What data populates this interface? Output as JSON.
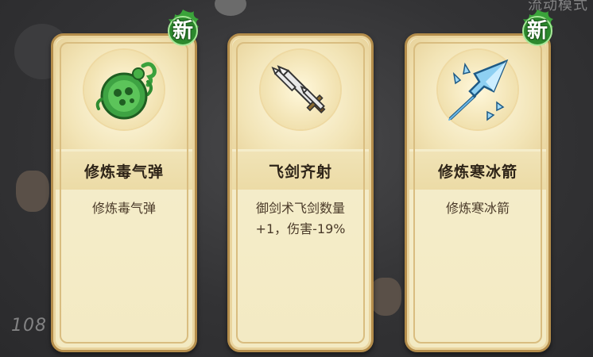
{
  "background": {
    "top_right_text": "流动模式",
    "bottom_left_text": "108"
  },
  "badge": {
    "new_label": "新"
  },
  "cards": [
    {
      "title": "修炼毒气弹",
      "description": "修炼毒气弹",
      "icon": "poison-gas-orb-icon",
      "is_new": true
    },
    {
      "title": "飞剑齐射",
      "description": "御剑术飞剑数量\n+1，伤害-19%",
      "icon": "flying-swords-icon",
      "is_new": false
    },
    {
      "title": "修炼寒冰箭",
      "description": "修炼寒冰箭",
      "icon": "ice-arrow-icon",
      "is_new": true
    }
  ],
  "colors": {
    "card_bg": "#f4ecc6",
    "card_border": "#b48d4b",
    "title_text": "#2e2418",
    "new_badge_green": "#3aa33a"
  }
}
